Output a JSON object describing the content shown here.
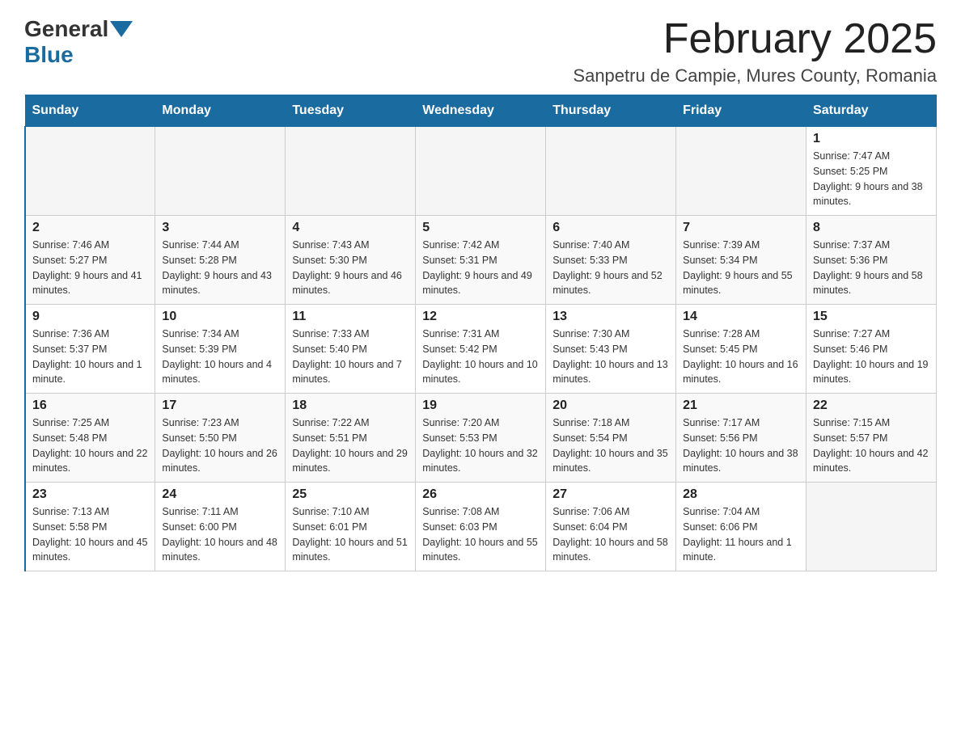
{
  "header": {
    "logo_general": "General",
    "logo_blue": "Blue",
    "title": "February 2025",
    "subtitle": "Sanpetru de Campie, Mures County, Romania"
  },
  "calendar": {
    "days_of_week": [
      "Sunday",
      "Monday",
      "Tuesday",
      "Wednesday",
      "Thursday",
      "Friday",
      "Saturday"
    ],
    "weeks": [
      [
        {
          "day": "",
          "info": ""
        },
        {
          "day": "",
          "info": ""
        },
        {
          "day": "",
          "info": ""
        },
        {
          "day": "",
          "info": ""
        },
        {
          "day": "",
          "info": ""
        },
        {
          "day": "",
          "info": ""
        },
        {
          "day": "1",
          "info": "Sunrise: 7:47 AM\nSunset: 5:25 PM\nDaylight: 9 hours and 38 minutes."
        }
      ],
      [
        {
          "day": "2",
          "info": "Sunrise: 7:46 AM\nSunset: 5:27 PM\nDaylight: 9 hours and 41 minutes."
        },
        {
          "day": "3",
          "info": "Sunrise: 7:44 AM\nSunset: 5:28 PM\nDaylight: 9 hours and 43 minutes."
        },
        {
          "day": "4",
          "info": "Sunrise: 7:43 AM\nSunset: 5:30 PM\nDaylight: 9 hours and 46 minutes."
        },
        {
          "day": "5",
          "info": "Sunrise: 7:42 AM\nSunset: 5:31 PM\nDaylight: 9 hours and 49 minutes."
        },
        {
          "day": "6",
          "info": "Sunrise: 7:40 AM\nSunset: 5:33 PM\nDaylight: 9 hours and 52 minutes."
        },
        {
          "day": "7",
          "info": "Sunrise: 7:39 AM\nSunset: 5:34 PM\nDaylight: 9 hours and 55 minutes."
        },
        {
          "day": "8",
          "info": "Sunrise: 7:37 AM\nSunset: 5:36 PM\nDaylight: 9 hours and 58 minutes."
        }
      ],
      [
        {
          "day": "9",
          "info": "Sunrise: 7:36 AM\nSunset: 5:37 PM\nDaylight: 10 hours and 1 minute."
        },
        {
          "day": "10",
          "info": "Sunrise: 7:34 AM\nSunset: 5:39 PM\nDaylight: 10 hours and 4 minutes."
        },
        {
          "day": "11",
          "info": "Sunrise: 7:33 AM\nSunset: 5:40 PM\nDaylight: 10 hours and 7 minutes."
        },
        {
          "day": "12",
          "info": "Sunrise: 7:31 AM\nSunset: 5:42 PM\nDaylight: 10 hours and 10 minutes."
        },
        {
          "day": "13",
          "info": "Sunrise: 7:30 AM\nSunset: 5:43 PM\nDaylight: 10 hours and 13 minutes."
        },
        {
          "day": "14",
          "info": "Sunrise: 7:28 AM\nSunset: 5:45 PM\nDaylight: 10 hours and 16 minutes."
        },
        {
          "day": "15",
          "info": "Sunrise: 7:27 AM\nSunset: 5:46 PM\nDaylight: 10 hours and 19 minutes."
        }
      ],
      [
        {
          "day": "16",
          "info": "Sunrise: 7:25 AM\nSunset: 5:48 PM\nDaylight: 10 hours and 22 minutes."
        },
        {
          "day": "17",
          "info": "Sunrise: 7:23 AM\nSunset: 5:50 PM\nDaylight: 10 hours and 26 minutes."
        },
        {
          "day": "18",
          "info": "Sunrise: 7:22 AM\nSunset: 5:51 PM\nDaylight: 10 hours and 29 minutes."
        },
        {
          "day": "19",
          "info": "Sunrise: 7:20 AM\nSunset: 5:53 PM\nDaylight: 10 hours and 32 minutes."
        },
        {
          "day": "20",
          "info": "Sunrise: 7:18 AM\nSunset: 5:54 PM\nDaylight: 10 hours and 35 minutes."
        },
        {
          "day": "21",
          "info": "Sunrise: 7:17 AM\nSunset: 5:56 PM\nDaylight: 10 hours and 38 minutes."
        },
        {
          "day": "22",
          "info": "Sunrise: 7:15 AM\nSunset: 5:57 PM\nDaylight: 10 hours and 42 minutes."
        }
      ],
      [
        {
          "day": "23",
          "info": "Sunrise: 7:13 AM\nSunset: 5:58 PM\nDaylight: 10 hours and 45 minutes."
        },
        {
          "day": "24",
          "info": "Sunrise: 7:11 AM\nSunset: 6:00 PM\nDaylight: 10 hours and 48 minutes."
        },
        {
          "day": "25",
          "info": "Sunrise: 7:10 AM\nSunset: 6:01 PM\nDaylight: 10 hours and 51 minutes."
        },
        {
          "day": "26",
          "info": "Sunrise: 7:08 AM\nSunset: 6:03 PM\nDaylight: 10 hours and 55 minutes."
        },
        {
          "day": "27",
          "info": "Sunrise: 7:06 AM\nSunset: 6:04 PM\nDaylight: 10 hours and 58 minutes."
        },
        {
          "day": "28",
          "info": "Sunrise: 7:04 AM\nSunset: 6:06 PM\nDaylight: 11 hours and 1 minute."
        },
        {
          "day": "",
          "info": ""
        }
      ]
    ]
  }
}
